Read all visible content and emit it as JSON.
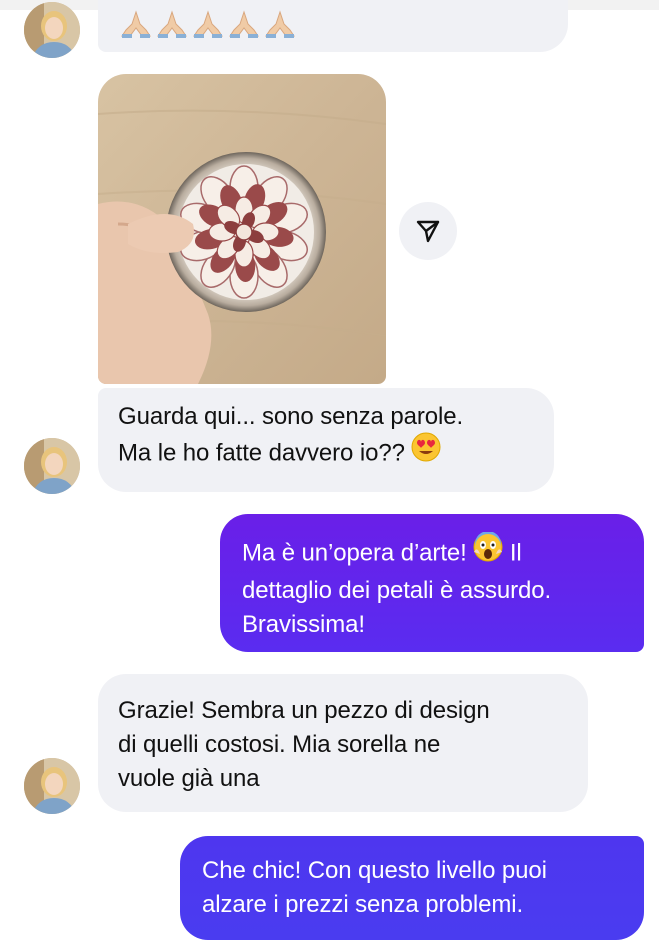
{
  "chat": {
    "contact": {
      "avatar_icon": "contact-avatar"
    },
    "colors": {
      "incoming_bg": "#f0f1f5",
      "outgoing_gradient_start": "#6a1fe8",
      "outgoing_gradient_end": "#4a3cf0",
      "text_dark": "#111111",
      "text_light": "#ffffff"
    },
    "messages": [
      {
        "direction": "incoming",
        "type": "emoji",
        "text": "🙏🏼🙏🏼🙏🏼🙏🏼🙏🏼",
        "emoji_icon": "folded-hands-emoji",
        "count": 5
      },
      {
        "direction": "incoming",
        "type": "photo",
        "photo_icon": "photo-flower-candle-in-glass",
        "share_icon": "send-share-icon"
      },
      {
        "direction": "incoming",
        "type": "text",
        "lines": [
          "Guarda qui... sono senza parole.",
          "Ma le ho fatte davvero io??"
        ],
        "trailing_emoji": "😍",
        "trailing_emoji_icon": "heart-eyes-emoji"
      },
      {
        "direction": "outgoing",
        "type": "text",
        "lines": [
          "Ma è un’opera d’arte!",
          " Il",
          "dettaglio dei petali è assurdo.",
          "Bravissima!"
        ],
        "inline_emoji": "😱",
        "inline_emoji_icon": "screaming-face-emoji"
      },
      {
        "direction": "incoming",
        "type": "text",
        "lines": [
          "Grazie! Sembra un pezzo di design",
          "di quelli costosi. Mia sorella ne",
          "vuole già una"
        ]
      },
      {
        "direction": "outgoing",
        "type": "text",
        "lines": [
          "Che chic! Con questo livello puoi",
          "alzare i prezzi senza problemi."
        ]
      }
    ]
  }
}
